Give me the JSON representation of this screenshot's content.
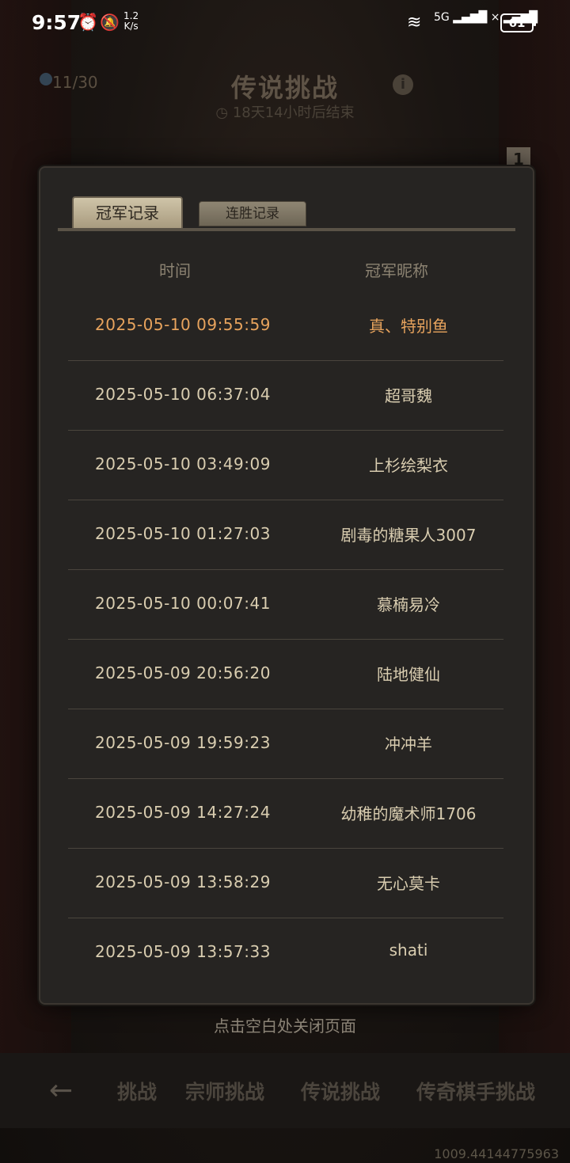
{
  "status_bar": {
    "time": "9:57",
    "speed_value": "1.2",
    "speed_unit": "K/s",
    "network": "5G",
    "battery": "61"
  },
  "background": {
    "counter": "11/30",
    "title": "传说挑战",
    "subtitle": "18天14小时后结束",
    "badge": "1"
  },
  "modal": {
    "tabs": [
      {
        "label": "冠军记录",
        "active": true
      },
      {
        "label": "连胜记录",
        "active": false
      }
    ],
    "columns": {
      "time": "时间",
      "name": "冠军昵称"
    },
    "rows": [
      {
        "time": "2025-05-10  09:55:59",
        "name": "真、特别鱼",
        "highlight": true
      },
      {
        "time": "2025-05-10  06:37:04",
        "name": "超哥魏",
        "highlight": false
      },
      {
        "time": "2025-05-10  03:49:09",
        "name": "上杉绘梨衣",
        "highlight": false
      },
      {
        "time": "2025-05-10  01:27:03",
        "name": "剧毒的糖果人3007",
        "highlight": false
      },
      {
        "time": "2025-05-10  00:07:41",
        "name": "慕楠易冷",
        "highlight": false
      },
      {
        "time": "2025-05-09  20:56:20",
        "name": "陆地健仙",
        "highlight": false
      },
      {
        "time": "2025-05-09  19:59:23",
        "name": "冲冲羊",
        "highlight": false
      },
      {
        "time": "2025-05-09  14:27:24",
        "name": "幼稚的魔术师1706",
        "highlight": false
      },
      {
        "time": "2025-05-09  13:58:29",
        "name": "无心莫卡",
        "highlight": false
      },
      {
        "time": "2025-05-09  13:57:33",
        "name": "shati",
        "highlight": false
      }
    ],
    "close_hint": "点击空白处关闭页面"
  },
  "bottom_nav": {
    "items": [
      "挑战",
      "宗师挑战",
      "传说挑战",
      "传奇棋手挑战"
    ]
  },
  "footer_id": "1009.44144775963",
  "colors": {
    "highlight": "#e7a35d",
    "text": "#d9cdb0"
  }
}
